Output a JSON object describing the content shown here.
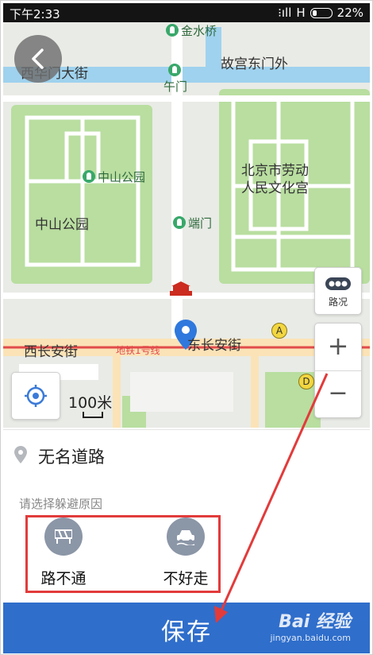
{
  "status_bar": {
    "time": "下午2:33",
    "signal": "H",
    "battery": "22%"
  },
  "map": {
    "labels": {
      "xihuamen": "西华门大街",
      "gugong_east_gate": "故宫东门外",
      "jinshuiqiao": "金水桥",
      "wumen": "午门",
      "zhongshan_park_poi": "中山公园",
      "zhongshan_park_area": "中山公园",
      "labor_palace": "北京市劳动人民文化宫",
      "duanmen": "端门",
      "west_changan": "西长安街",
      "east_changan": "东长安街",
      "subway_line1": "地铁1号线"
    },
    "traffic_label": "路况",
    "zoom_in": "+",
    "zoom_out": "−",
    "scale": "100米",
    "station_a": "A",
    "station_d": "D"
  },
  "road": {
    "name": "无名道路"
  },
  "reasons": {
    "title": "请选择躲避原因",
    "items": [
      {
        "label": "路不通",
        "icon": "roadblock-icon"
      },
      {
        "label": "不好走",
        "icon": "car-icon"
      }
    ]
  },
  "save": {
    "label": "保存"
  },
  "watermark": {
    "line1": "Bai 经验",
    "line2": "jingyan.baidu.com"
  },
  "colors": {
    "save_blue": "#2f6ecb",
    "highlight_red": "#e23b3b",
    "park_green": "#b9dea0",
    "water_blue": "#9fd2ee"
  }
}
